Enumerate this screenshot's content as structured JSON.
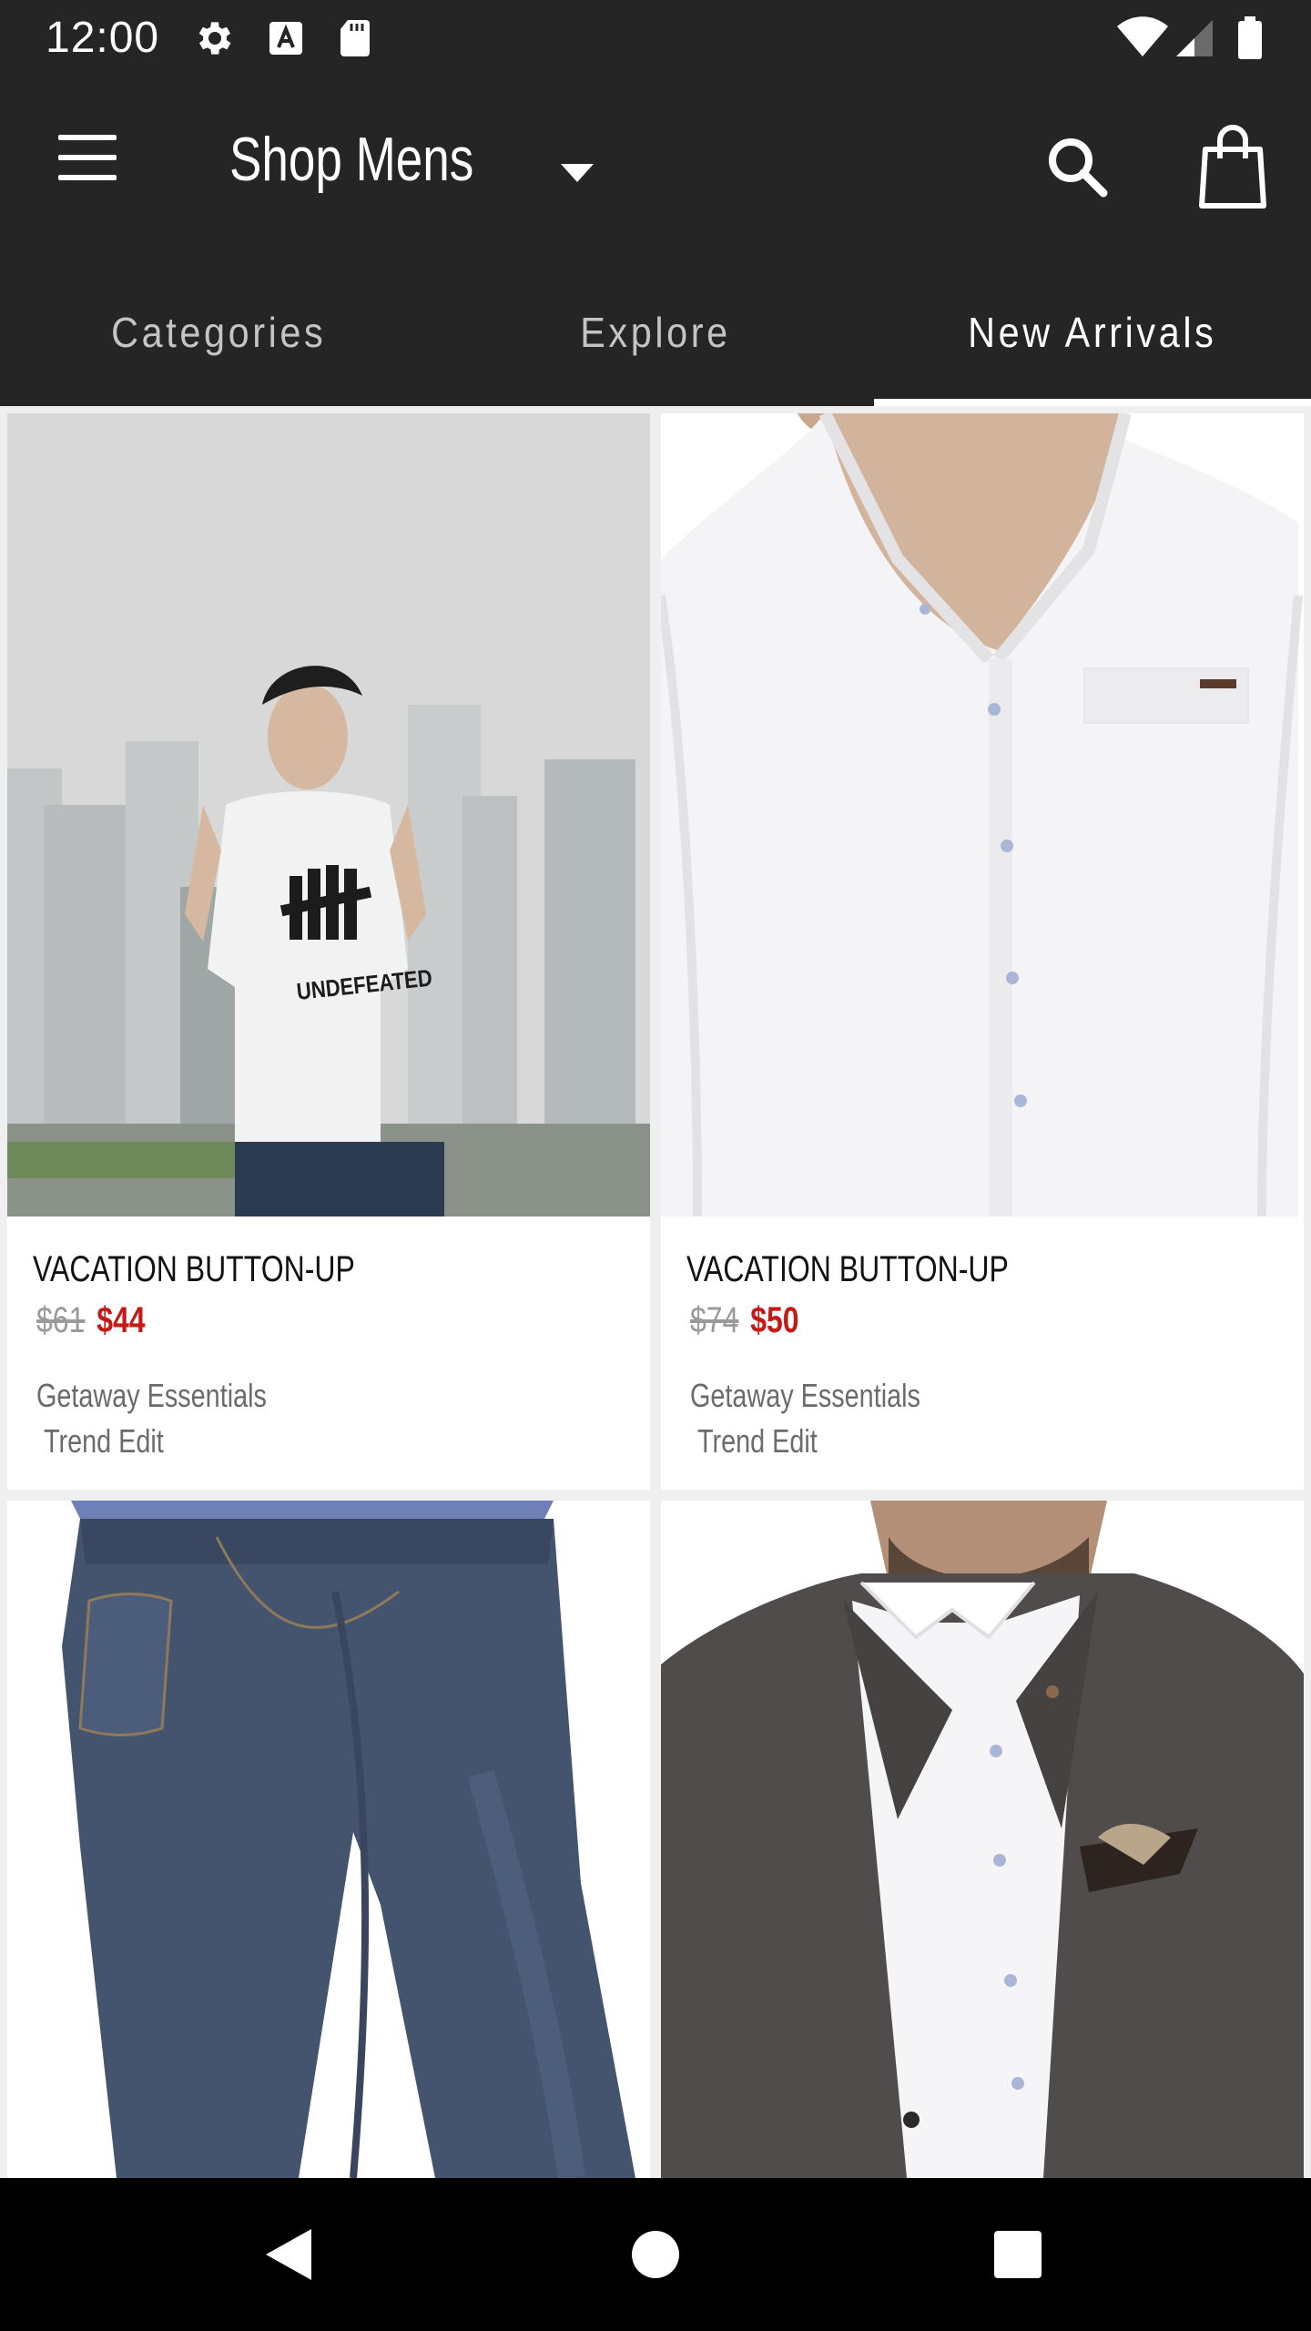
{
  "status_bar": {
    "time": "12:00",
    "icons": [
      "settings-icon",
      "text-a-icon",
      "sd-card-icon",
      "wifi-icon",
      "signal-icon",
      "battery-icon"
    ]
  },
  "app_bar": {
    "title": "Shop Mens",
    "menu_icon": "hamburger-menu-icon",
    "dropdown_icon": "caret-down-icon",
    "search_icon": "search-icon",
    "bag_icon": "shopping-bag-icon"
  },
  "tabs": [
    {
      "label": "Categories",
      "active": false
    },
    {
      "label": "Explore",
      "active": false
    },
    {
      "label": "New Arrivals",
      "active": true
    }
  ],
  "products": [
    {
      "name": "VACATION BUTTON-UP",
      "price_old": "$61",
      "price_new": "$44",
      "tags": [
        "Getaway Essentials",
        "Trend Edit"
      ]
    },
    {
      "name": "VACATION BUTTON-UP",
      "price_old": "$74",
      "price_new": "$50",
      "tags": [
        "Getaway Essentials",
        "Trend Edit"
      ]
    },
    {
      "name": "",
      "price_old": "",
      "price_new": "",
      "tags": []
    },
    {
      "name": "",
      "price_old": "",
      "price_new": "",
      "tags": []
    }
  ],
  "graphic_text": {
    "shirt_print": "UNDEFEATED"
  },
  "colors": {
    "bar_bg": "#252525",
    "sale_price": "#c61a16",
    "old_price": "#9a9a9a"
  }
}
